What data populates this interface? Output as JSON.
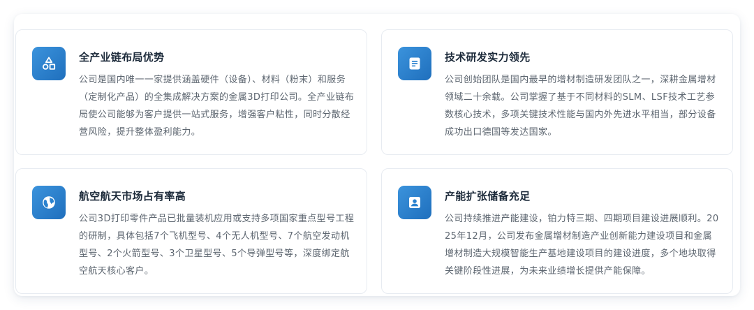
{
  "cards": [
    {
      "title": "全产业链布局优势",
      "icon": "shapes-icon",
      "body": "公司是国内唯一一家提供涵盖硬件（设备）、材料（粉末）和服务（定制化产品）的全集成解决方案的金属3D打印公司。全产业链布局使公司能够为客户提供一站式服务，增强客户粘性，同时分散经营风险，提升整体盈利能力。"
    },
    {
      "title": "技术研发实力领先",
      "icon": "document-icon",
      "body": "公司创始团队是国内最早的增材制造研发团队之一，深耕金属增材领域二十余载。公司掌握了基于不同材料的SLM、LSF技术工艺参数核心技术，多项关键技术性能与国内外先进水平相当，部分设备成功出口德国等发达国家。"
    },
    {
      "title": "航空航天市场占有率高",
      "icon": "globe-icon",
      "body": "公司3D打印零件产品已批量装机应用或支持多项国家重点型号工程的研制，具体包括7个飞机型号、4个无人机型号、7个航空发动机型号、2个火箭型号、3个卫星型号、5个导弹型号等，深度绑定航空航天核心客户。"
    },
    {
      "title": "产能扩张储备充足",
      "icon": "user-badge-icon",
      "body": "公司持续推进产能建设，铂力特三期、四期项目建设进展顺利。2025年12月，公司发布金属增材制造产业创新能力建设项目和金属增材制造大规模智能生产基地建设项目的建设进度，多个地块取得关键阶段性进展，为未来业绩增长提供产能保障。"
    }
  ],
  "colors": {
    "accent": "#2a82cf",
    "title": "#1c2a3a",
    "body": "#5d6670",
    "border": "#e7ebf1"
  }
}
